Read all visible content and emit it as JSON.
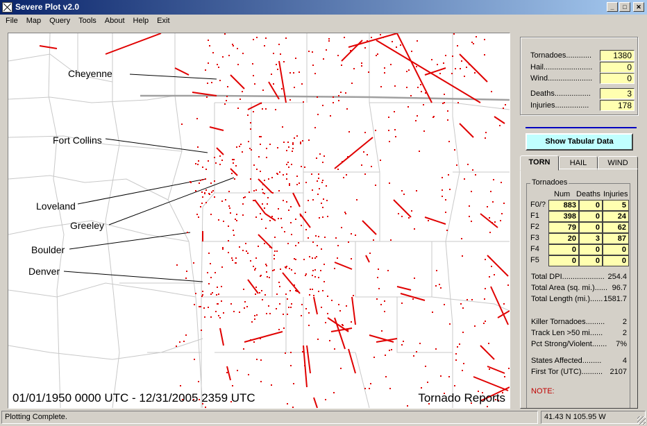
{
  "window": {
    "title": "Severe Plot v2.0",
    "buttons": [
      "_",
      "□",
      "✕"
    ]
  },
  "menu": [
    "File",
    "Map",
    "Query",
    "Tools",
    "About",
    "Help",
    "Exit"
  ],
  "map": {
    "cities": [
      {
        "name": "Cheyenne"
      },
      {
        "name": "Fort Collins"
      },
      {
        "name": "Loveland"
      },
      {
        "name": "Greeley"
      },
      {
        "name": "Boulder"
      },
      {
        "name": "Denver"
      }
    ],
    "date_range": "01/01/1950 0000 UTC - 12/31/2005 2359 UTC",
    "report_type": "Tornado Reports",
    "track_color": "#e00000",
    "state_border_color": "#a0a0a0",
    "county_border_color": "#c8c8c8"
  },
  "summary": [
    {
      "label": "Tornadoes",
      "value": "1380"
    },
    {
      "label": "Hail",
      "value": "0"
    },
    {
      "label": "Wind",
      "value": "0"
    },
    {
      "label": "Deaths",
      "value": "3"
    },
    {
      "label": "Injuries",
      "value": "178"
    }
  ],
  "show_button": "Show Tabular Data",
  "tabs": [
    "TORN",
    "HAIL",
    "WIND"
  ],
  "tornadoes": {
    "group_title": "Tornadoes",
    "columns": [
      "Num",
      "Deaths",
      "Injuries"
    ],
    "rows": [
      {
        "label": "F0/?",
        "num": "883",
        "deaths": "0",
        "injuries": "5"
      },
      {
        "label": "F1",
        "num": "398",
        "deaths": "0",
        "injuries": "24"
      },
      {
        "label": "F2",
        "num": "79",
        "deaths": "0",
        "injuries": "62"
      },
      {
        "label": "F3",
        "num": "20",
        "deaths": "3",
        "injuries": "87"
      },
      {
        "label": "F4",
        "num": "0",
        "deaths": "0",
        "injuries": "0"
      },
      {
        "label": "F5",
        "num": "0",
        "deaths": "0",
        "injuries": "0"
      }
    ],
    "stats_a": [
      {
        "label": "Total DPI",
        "value": "254.4"
      },
      {
        "label": "Total Area (sq. mi.)",
        "value": "96.7"
      },
      {
        "label": "Total Length (mi.)",
        "value": "1581.7"
      }
    ],
    "stats_b": [
      {
        "label": "Killer Tornadoes",
        "value": "2"
      },
      {
        "label": "Track Len >50 mi",
        "value": "2"
      },
      {
        "label": "Pct Strong/Violent",
        "value": "7%"
      }
    ],
    "stats_c": [
      {
        "label": "States Affected",
        "value": "4"
      },
      {
        "label": "First Tor (UTC)",
        "value": "2107"
      }
    ],
    "note": "NOTE:"
  },
  "status": {
    "message": "Plotting Complete.",
    "coords": "41.43 N  105.95 W"
  }
}
